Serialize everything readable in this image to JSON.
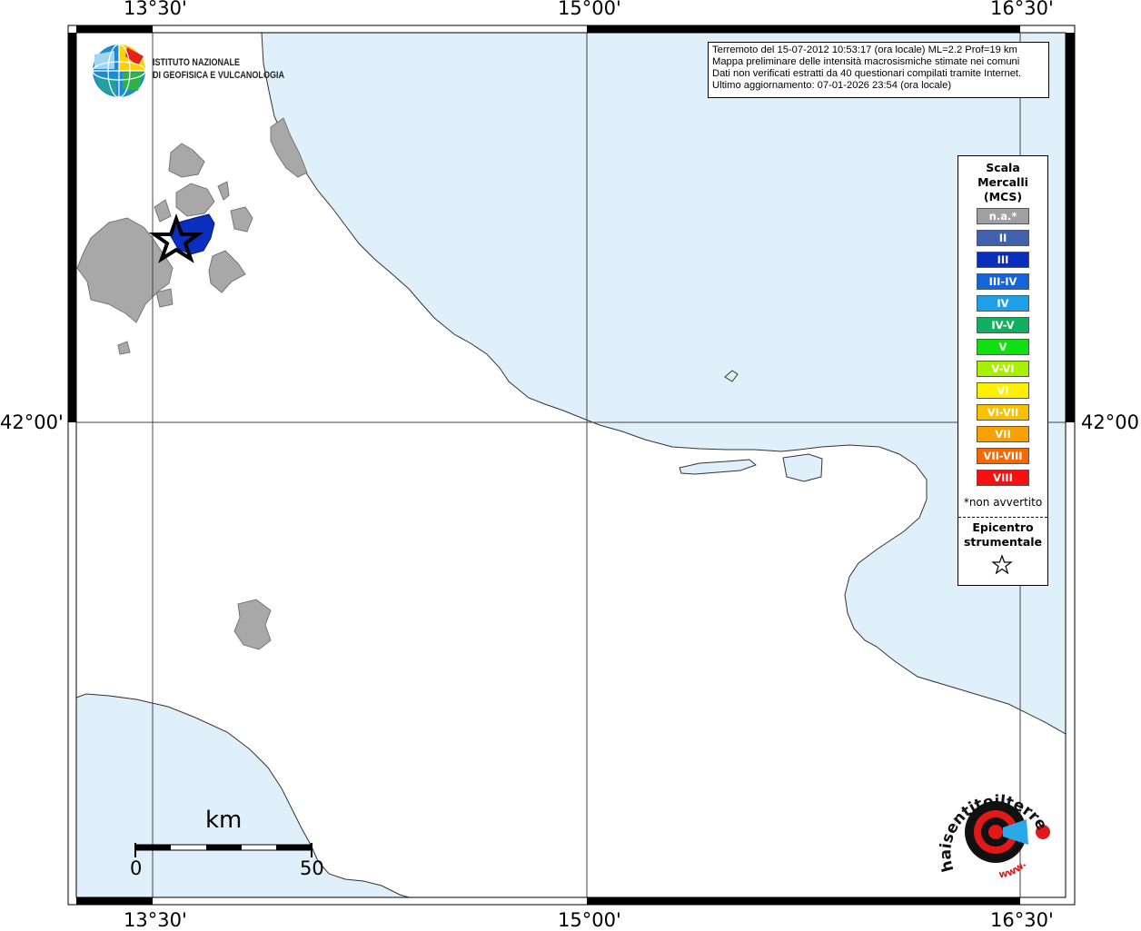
{
  "map": {
    "top_coords": [
      "13°30'",
      "15°00'",
      "16°30'"
    ],
    "bottom_coords": [
      "13°30'",
      "15°00'",
      "16°30'"
    ],
    "lat_left": "42°00'",
    "lat_right": "42°00'",
    "colors": {
      "sea": "#e0f0fb",
      "felt": "#a8a8a8",
      "intensity_III": "#0a2fbf",
      "frame": "#000000"
    }
  },
  "institute": {
    "line1": "ISTITUTO NAZIONALE",
    "line2": "DI GEOFISICA E VULCANOLOGIA"
  },
  "info": {
    "line1": "Terremoto del 15-07-2012 10:53:17 (ora locale) ML=2.2 Prof=19 km",
    "line2": "Mappa preliminare delle intensità macrosismiche stimate nei comuni",
    "line3": "Dati non verificati estratti da 40 questionari compilati tramite Internet.",
    "line4": "Ultimo aggiornamento: 07-01-2026 23:54 (ora locale)"
  },
  "legend": {
    "title1": "Scala",
    "title2": "Mercalli",
    "title3": "(MCS)",
    "items": [
      {
        "label": "n.a.*",
        "color": "#a0a0a0"
      },
      {
        "label": "II",
        "color": "#4060b0"
      },
      {
        "label": "III",
        "color": "#0a2fbf"
      },
      {
        "label": "III-IV",
        "color": "#1466d8"
      },
      {
        "label": "IV",
        "color": "#1ea0e8"
      },
      {
        "label": "IV-V",
        "color": "#10b060"
      },
      {
        "label": "V",
        "color": "#10e010"
      },
      {
        "label": "V-VI",
        "color": "#a8f000"
      },
      {
        "label": "VI",
        "color": "#fff000"
      },
      {
        "label": "VI-VII",
        "color": "#f8c000"
      },
      {
        "label": "VII",
        "color": "#f8a000"
      },
      {
        "label": "VII-VIII",
        "color": "#f86800"
      },
      {
        "label": "VIII",
        "color": "#f81010"
      }
    ],
    "note": "*non avvertito",
    "epi1": "Epicentro",
    "epi2": "strumentale"
  },
  "scale_bar": {
    "unit": "km",
    "start": "0",
    "end": "50"
  },
  "hsi_logo": {
    "text": "haisentitoilterremoto.it",
    "www": "www."
  }
}
